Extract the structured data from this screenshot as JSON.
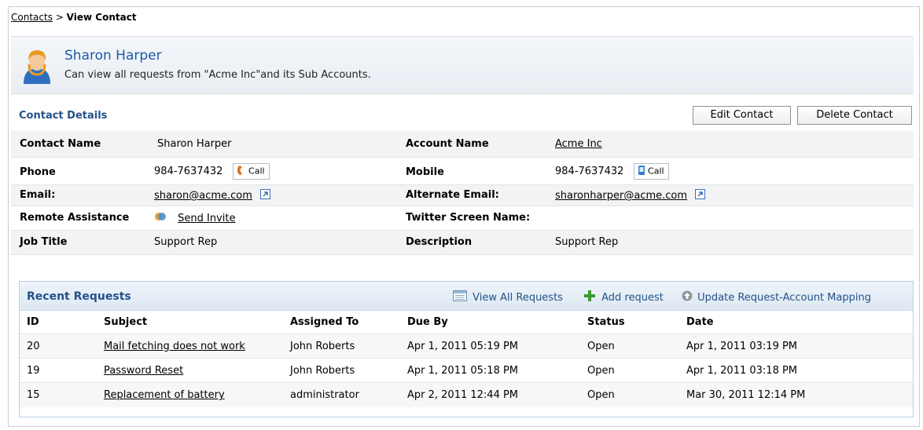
{
  "breadcrumb": {
    "parent": "Contacts",
    "separator": ">",
    "current": "View Contact"
  },
  "header": {
    "name": "Sharon Harper",
    "description": "Can view all requests from \"Acme Inc\"and its Sub Accounts."
  },
  "contact_details": {
    "title": "Contact Details",
    "edit_label": "Edit Contact",
    "delete_label": "Delete Contact",
    "contact_name_label": "Contact Name",
    "contact_name": "Sharon Harper",
    "account_name_label": "Account Name",
    "account_name": "Acme Inc",
    "phone_label": "Phone",
    "phone": "984-7637432",
    "mobile_label": "Mobile",
    "mobile": "984-7637432",
    "call_label": "Call",
    "email_label": "Email:",
    "email": "sharon@acme.com",
    "alt_email_label": "Alternate Email:",
    "alt_email": "sharonharper@acme.com",
    "remote_label": "Remote Assistance",
    "send_invite": "Send Invite",
    "twitter_label": "Twitter Screen Name:",
    "twitter": "",
    "job_title_label": "Job Title",
    "job_title": "Support Rep",
    "description_label": "Description",
    "description": "Support Rep"
  },
  "recent_requests": {
    "title": "Recent Requests",
    "view_all": "View All Requests",
    "add_request": "Add request",
    "update_mapping": "Update Request-Account Mapping",
    "columns": [
      "ID",
      "Subject",
      "Assigned To",
      "Due By",
      "Status",
      "Date"
    ],
    "rows": [
      {
        "id": "20",
        "subject": "Mail fetching does not work",
        "assigned": "John Roberts",
        "due": "Apr 1, 2011 05:19 PM",
        "status": "Open",
        "date": "Apr 1, 2011 03:19 PM"
      },
      {
        "id": "19",
        "subject": "Password Reset",
        "assigned": "John Roberts",
        "due": "Apr 1, 2011 05:18 PM",
        "status": "Open",
        "date": "Apr 1, 2011 03:18 PM"
      },
      {
        "id": "15",
        "subject": "Replacement of battery",
        "assigned": "administrator",
        "due": "Apr 2, 2011 12:44 PM",
        "status": "Open",
        "date": "Mar 30, 2011 12:14 PM"
      }
    ]
  },
  "colors": {
    "accent": "#1d5aa8",
    "section_title": "#23528a",
    "border": "#b9cfe4",
    "add_icon": "#3a9a2f"
  }
}
